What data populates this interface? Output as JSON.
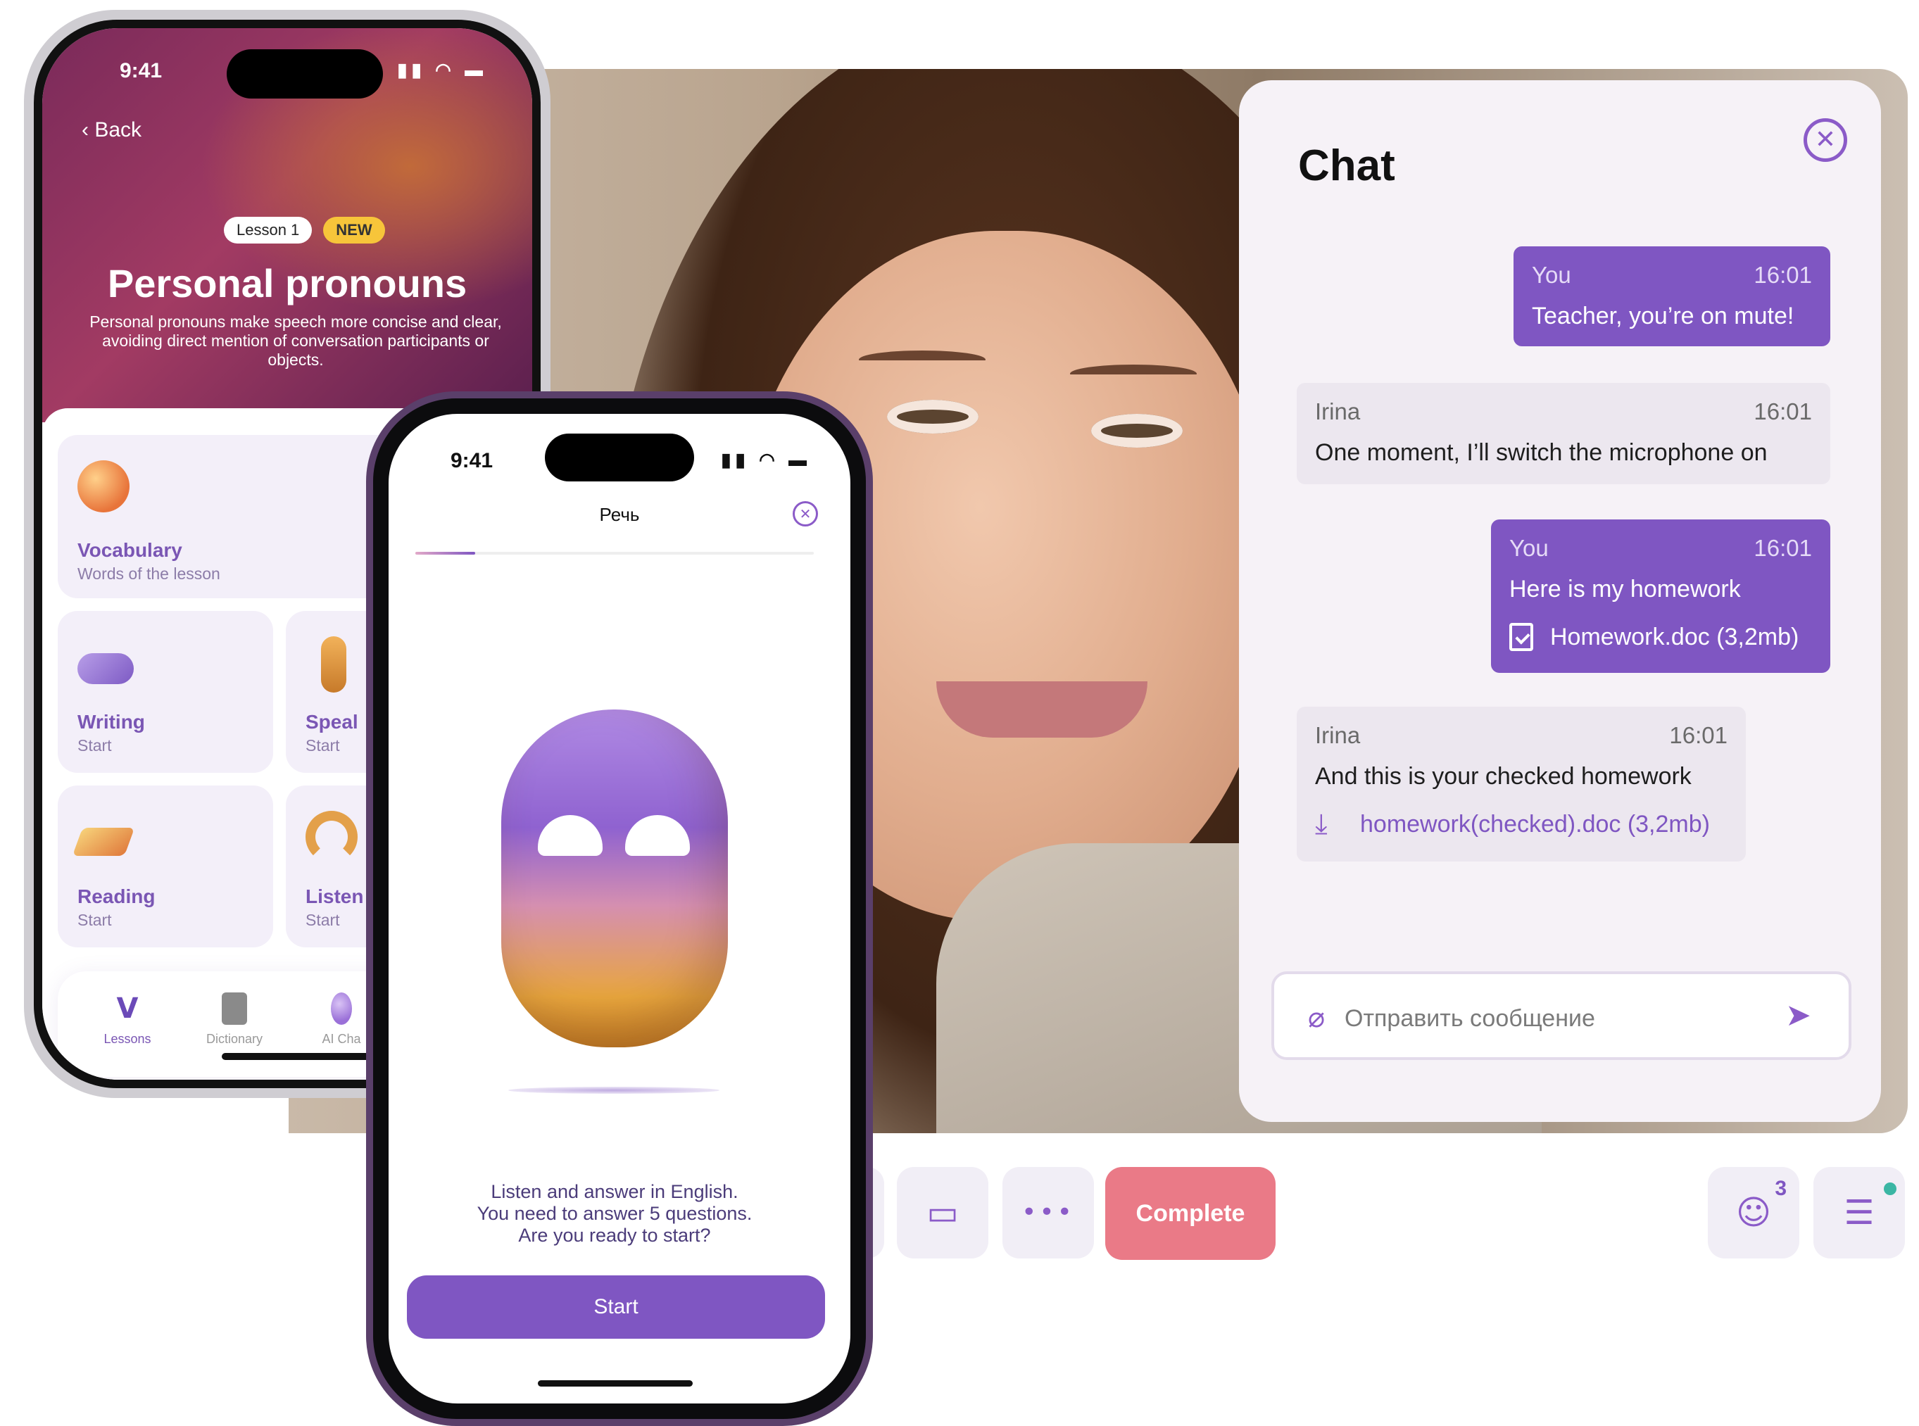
{
  "colors": {
    "accent": "#7f56c2",
    "complete": "#ea7a87",
    "badge_new": "#f7c53a",
    "online_dot": "#3bb6a4"
  },
  "chat": {
    "title": "Chat",
    "close_icon": "close-circle-icon",
    "messages": [
      {
        "author": "You",
        "time": "16:01",
        "text": "Teacher, you’re on mute!",
        "own": true
      },
      {
        "author": "Irina",
        "time": "16:01",
        "text": "One moment, I’ll switch the microphone on",
        "own": false
      },
      {
        "author": "You",
        "time": "16:01",
        "text": "Here is my homework",
        "own": true,
        "file": "Homework.doc (3,2mb)"
      },
      {
        "author": "Irina",
        "time": "16:01",
        "text": "And this is your checked homework",
        "own": false,
        "file": "homework(checked).doc (3,2mb)"
      }
    ],
    "composer_placeholder": "Отправить сообщение",
    "attach_icon": "paperclip-icon",
    "send_icon": "send-icon"
  },
  "toolbar": {
    "complete_label": "Complete",
    "participants_count": "3",
    "buttons": [
      "screen-share-icon",
      "more-icon",
      "participants-icon",
      "chat-icon"
    ]
  },
  "phone1": {
    "time": "9:41",
    "back_label": "Back",
    "lesson_badge": "Lesson 1",
    "new_badge": "NEW",
    "title": "Personal pronouns",
    "description": "Personal pronouns make speech more concise and clear, avoiding direct mention of conversation participants or objects.",
    "cards": [
      {
        "title": "Vocabulary",
        "subtitle": "Words of the lesson"
      },
      {
        "title": "Writing",
        "subtitle": "Start"
      },
      {
        "title": "Speal",
        "subtitle": "Start"
      },
      {
        "title": "Reading",
        "subtitle": "Start"
      },
      {
        "title": "Listen",
        "subtitle": "Start"
      }
    ],
    "nav": [
      {
        "label": "Lessons"
      },
      {
        "label": "Dictionary"
      },
      {
        "label": "AI Cha"
      }
    ]
  },
  "phone2": {
    "time": "9:41",
    "header": "Речь",
    "progress": 0.15,
    "instructions": [
      "Listen and answer in English.",
      "You need to answer 5 questions.",
      "Are you ready to start?"
    ],
    "start_label": "Start"
  }
}
